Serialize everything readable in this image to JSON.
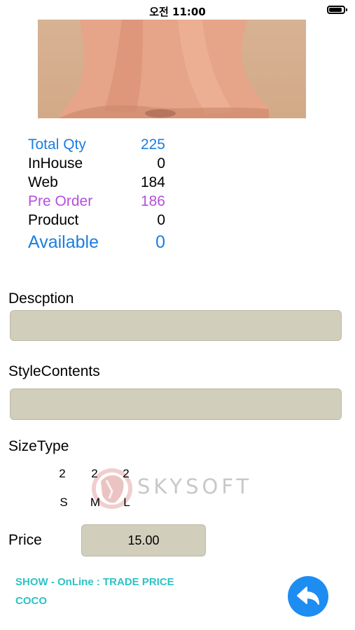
{
  "status_bar": {
    "time": "오전 11:00",
    "battery_level": 1.0
  },
  "stock": [
    {
      "label": "Total Qty",
      "value": "225",
      "color": "#1c7ee0"
    },
    {
      "label": "InHouse",
      "value": "0",
      "color": "#000000"
    },
    {
      "label": "Web",
      "value": "184",
      "color": "#000000"
    },
    {
      "label": "Pre Order",
      "value": "186",
      "color": "#b44fdc"
    },
    {
      "label": "Product",
      "value": "0",
      "color": "#000000"
    },
    {
      "label": "Available",
      "value": "0",
      "color": "#1c7ee0"
    }
  ],
  "description": {
    "label": "Descption",
    "value": ""
  },
  "style_contents": {
    "label": "StyleContents",
    "value": ""
  },
  "size_type": {
    "label": "SizeType",
    "sizes": [
      {
        "qty": "2",
        "name": "S"
      },
      {
        "qty": "2",
        "name": "M"
      },
      {
        "qty": "2",
        "name": "L"
      }
    ]
  },
  "watermark": {
    "text": "SKYSOFT"
  },
  "price": {
    "label": "Price",
    "value": "15.00"
  },
  "info": {
    "line1": "SHOW - OnLine : TRADE PRICE",
    "line2": "COCO"
  },
  "colors": {
    "accent": "#1d8df2",
    "field_bg": "#d1cebc",
    "info": "#2cc3c6"
  }
}
